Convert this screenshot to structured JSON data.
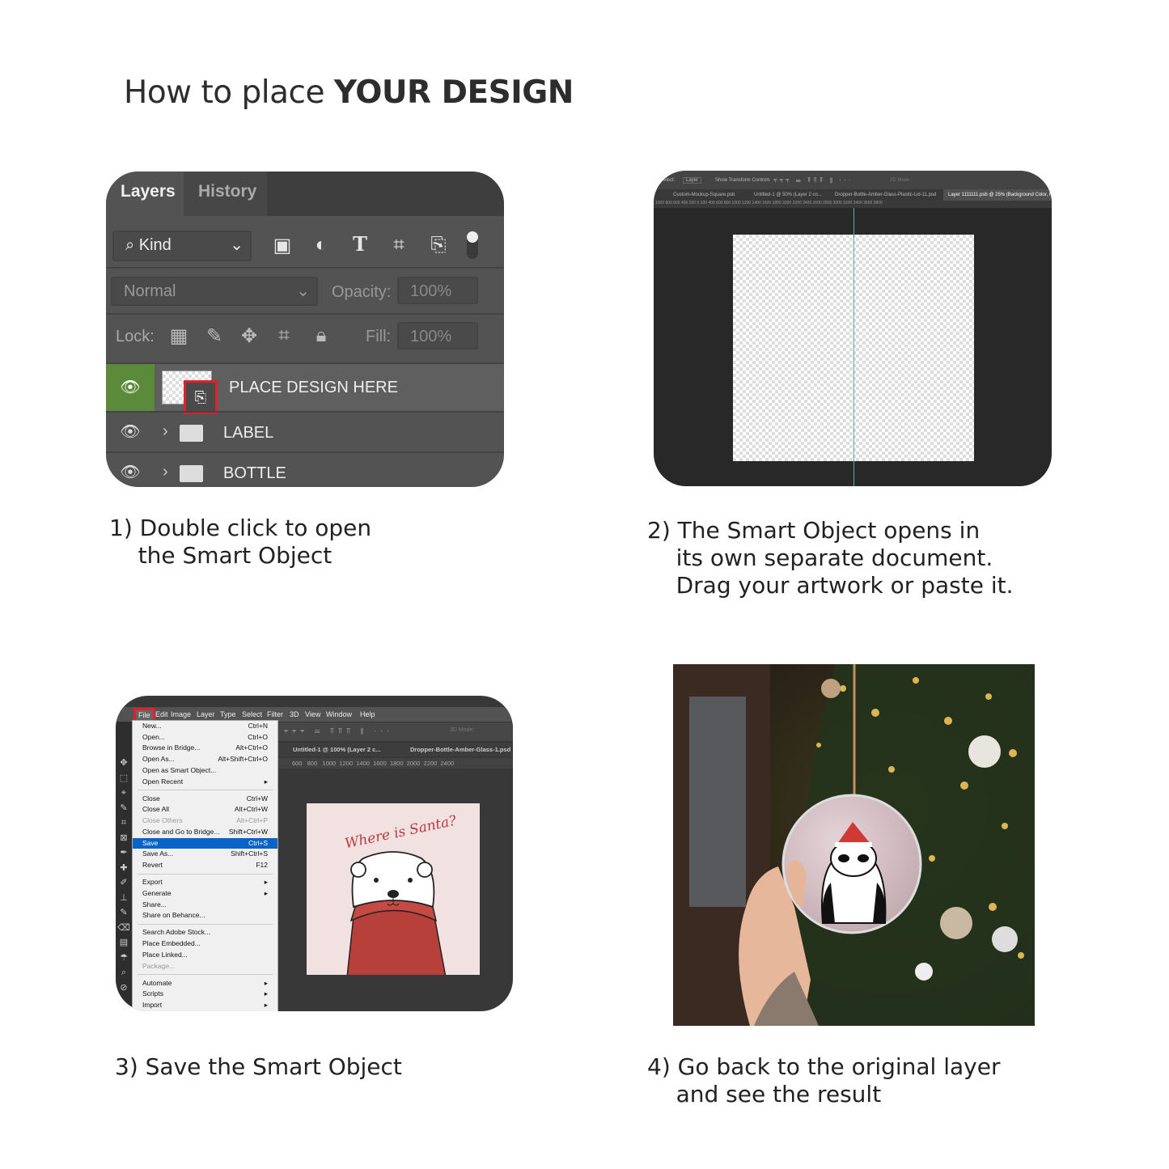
{
  "title": {
    "normal": "How to place ",
    "bold": "YOUR DESIGN"
  },
  "steps": [
    {
      "caption": "1) Double click to open\n    the Smart Object"
    },
    {
      "caption": "2) The Smart Object opens in\n    its own separate document.\n    Drag your artwork or paste it."
    },
    {
      "caption": "3) Save the Smart Object"
    },
    {
      "caption": "4) Go back to the original layer\n    and see the result"
    }
  ],
  "layers_panel": {
    "tabs": [
      "Layers",
      "History"
    ],
    "filter": "Kind",
    "blend_mode": "Normal",
    "opacity_label": "Opacity:",
    "opacity": "100%",
    "lock_label": "Lock:",
    "fill_label": "Fill:",
    "fill": "100%",
    "layers": [
      {
        "name": "PLACE DESIGN HERE",
        "type": "smart-object",
        "selected": true
      },
      {
        "name": "LABEL",
        "type": "group"
      },
      {
        "name": "BOTTLE",
        "type": "group"
      }
    ],
    "accent": "#e0202a",
    "eye_active_bg": "#5b8a3a"
  },
  "doc_window": {
    "options": {
      "select": "Select:",
      "layer": "Layer",
      "transform": "Show Transform Controls",
      "mode3d": "3D Mode:"
    },
    "tabs": [
      "Custom-Mockup-Square.psb",
      "Untitled-1 @ 50% (Layer 2 co...",
      "Dropper-Bottle-Amber-Glass-Plastic-Lid-11.psd",
      "Layer 1111111.psb @ 25% (Background Color, RG"
    ],
    "ruler": "1000  800  600  400  200  0      200  400  600  800  1000  1200  1400  1600  1800  2000  2200  2400  2600  2800  3000  3200  3400  3600  3800"
  },
  "save_window": {
    "menubar": [
      "File",
      "Edit",
      "Image",
      "Layer",
      "Type",
      "Select",
      "Filter",
      "3D",
      "View",
      "Window",
      "Help"
    ],
    "menu": [
      {
        "label": "New...",
        "shortcut": "Ctrl+N"
      },
      {
        "label": "Open...",
        "shortcut": "Ctrl+O"
      },
      {
        "label": "Browse in Bridge...",
        "shortcut": "Alt+Ctrl+O"
      },
      {
        "label": "Open As...",
        "shortcut": "Alt+Shift+Ctrl+O"
      },
      {
        "label": "Open as Smart Object...",
        "shortcut": ""
      },
      {
        "label": "Open Recent",
        "shortcut": "▸"
      },
      {
        "sep": true
      },
      {
        "label": "Close",
        "shortcut": "Ctrl+W"
      },
      {
        "label": "Close All",
        "shortcut": "Alt+Ctrl+W"
      },
      {
        "label": "Close Others",
        "shortcut": "Alt+Ctrl+P",
        "disabled": true
      },
      {
        "label": "Close and Go to Bridge...",
        "shortcut": "Shift+Ctrl+W"
      },
      {
        "label": "Save",
        "shortcut": "Ctrl+S",
        "selected": true
      },
      {
        "label": "Save As...",
        "shortcut": "Shift+Ctrl+S"
      },
      {
        "label": "Revert",
        "shortcut": "F12"
      },
      {
        "sep": true
      },
      {
        "label": "Export",
        "shortcut": "▸"
      },
      {
        "label": "Generate",
        "shortcut": "▸"
      },
      {
        "label": "Share...",
        "shortcut": ""
      },
      {
        "label": "Share on Behance...",
        "shortcut": ""
      },
      {
        "sep": true
      },
      {
        "label": "Search Adobe Stock...",
        "shortcut": ""
      },
      {
        "label": "Place Embedded...",
        "shortcut": ""
      },
      {
        "label": "Place Linked...",
        "shortcut": ""
      },
      {
        "label": "Package...",
        "shortcut": "",
        "disabled": true
      },
      {
        "sep": true
      },
      {
        "label": "Automate",
        "shortcut": "▸"
      },
      {
        "label": "Scripts",
        "shortcut": "▸"
      },
      {
        "label": "Import",
        "shortcut": "▸"
      }
    ],
    "tabs": [
      "Untitled-1 @ 100% (Layer 2 c...",
      "Dropper-Bottle-Amber-Glass-1.psd"
    ],
    "ruler": "600   800   1000  1200  1400  1600  1800  2000  2200  2400",
    "mode3d": "3D Mode:",
    "artwork_text": "Where is Santa?"
  }
}
